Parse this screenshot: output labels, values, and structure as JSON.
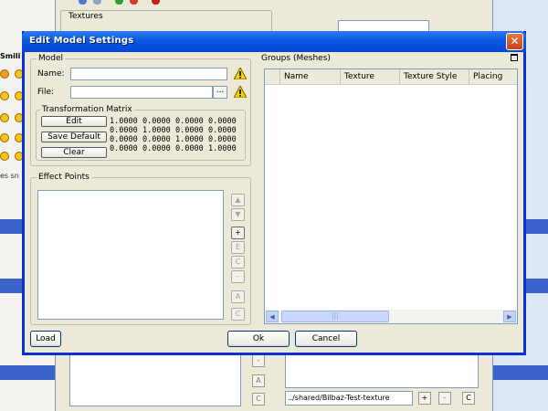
{
  "background": {
    "textures_label": "Textures",
    "left_header": "Smili",
    "left_text": "es sn",
    "path_value": "../shared/Bilbaz-Test-texture",
    "small_buttons": {
      "minus": "-",
      "a": "A",
      "c": "C",
      "plus": "+",
      "minus2": "-",
      "c2": "C"
    },
    "colors": {
      "desktop_band": "#3b63c9",
      "window_bg": "#ece9d8"
    }
  },
  "dialog": {
    "title": "Edit Model Settings",
    "close_label": "✕",
    "model_group": {
      "label": "Model",
      "name_label": "Name:",
      "name_value": "",
      "file_label": "File:",
      "file_value": "",
      "browse_label": "...",
      "warning_icon": "warning-icon"
    },
    "matrix_group": {
      "label": "Transformation Matrix",
      "buttons": [
        "Edit",
        "Save Default",
        "Clear"
      ],
      "rows": [
        [
          "1.0000",
          "0.0000",
          "0.0000",
          "0.0000"
        ],
        [
          "0.0000",
          "1.0000",
          "0.0000",
          "0.0000"
        ],
        [
          "0.0000",
          "0.0000",
          "1.0000",
          "0.0000"
        ],
        [
          "0.0000",
          "0.0000",
          "0.0000",
          "1.0000"
        ]
      ]
    },
    "effect_points": {
      "label": "Effect Points",
      "buttons": {
        "up": "▲",
        "down": "▼",
        "add": "+",
        "edit": "E",
        "copy": "C",
        "remove": "-",
        "a": "A",
        "c": "C"
      }
    },
    "groups": {
      "label": "Groups (Meshes)",
      "columns": [
        "Name",
        "Texture",
        "Texture Style",
        "Placing"
      ],
      "rows": [],
      "scroll_left": "◀",
      "scroll_right": "▶",
      "scroll_grip": "|||"
    },
    "buttons": {
      "load": "Load",
      "ok": "Ok",
      "cancel": "Cancel"
    },
    "colors": {
      "title_bar": "#0a57e0",
      "close_button": "#d5562a",
      "border": "#0831d9"
    }
  }
}
